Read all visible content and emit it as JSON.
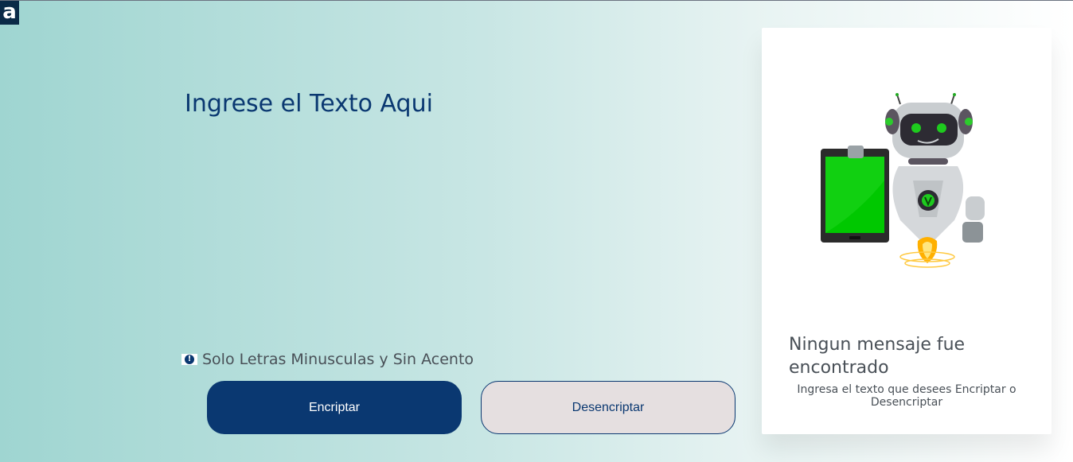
{
  "logo": {
    "letter": "a"
  },
  "input": {
    "placeholder": "Ingrese el Texto Aqui",
    "value": ""
  },
  "hint": {
    "icon": "exclamation-circle-icon",
    "text": "Solo Letras Minusculas y Sin Acento"
  },
  "buttons": {
    "encrypt_label": "Encriptar",
    "decrypt_label": "Desencriptar"
  },
  "output": {
    "illustration": "robot-with-tablet",
    "title": "Ningun mensaje fue encontrado",
    "subtitle": "Ingresa el texto que desees Encriptar o Desencriptar"
  },
  "colors": {
    "primary": "#0a3871",
    "secondary_button": "#e5dfe0",
    "text_gray": "#495057",
    "screen_green": "#00c800"
  }
}
